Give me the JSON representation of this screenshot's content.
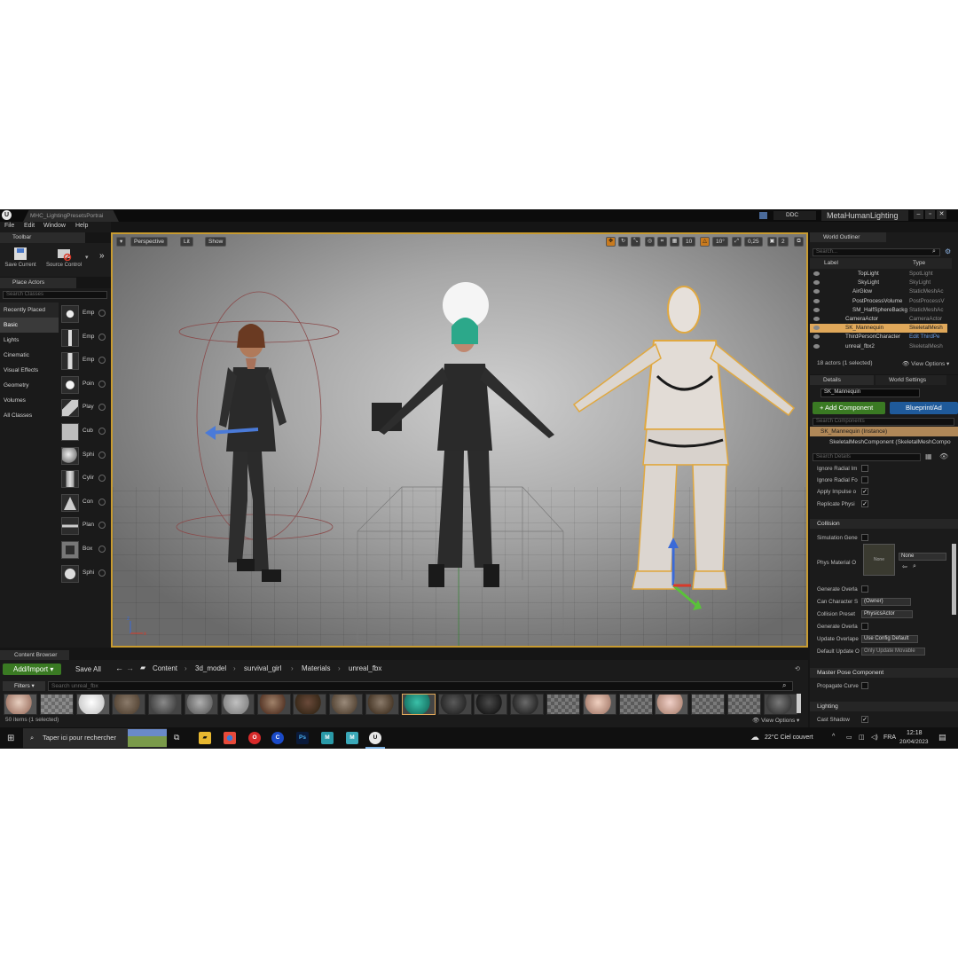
{
  "app": {
    "doc_tab": "MHC_LightingPresetsPortrai",
    "ddc": "DDC",
    "project_name": "MetaHumanLighting"
  },
  "menu": [
    "File",
    "Edit",
    "Window",
    "Help"
  ],
  "toolbar": {
    "tab": "Toolbar",
    "save_current": "Save Current",
    "source_control": "Source Control"
  },
  "place_actors": {
    "tab": "Place Actors",
    "search_placeholder": "Search Classes",
    "categories": [
      "Recently Placed",
      "Basic",
      "Lights",
      "Cinematic",
      "Visual Effects",
      "Geometry",
      "Volumes",
      "All Classes"
    ],
    "actors": [
      "Emp",
      "Emp",
      "Emp",
      "Poin",
      "Play",
      "Cub",
      "Sphi",
      "Cylir",
      "Con",
      "Plan",
      "Box",
      "Sphi"
    ]
  },
  "viewport": {
    "perspective": "Perspective",
    "lit": "Lit",
    "show": "Show",
    "grid_snap": "10",
    "rot_snap": "10°",
    "scale_snap": "0,25",
    "cam_speed": "2"
  },
  "outliner": {
    "tab": "World Outliner",
    "search_placeholder": "Search...",
    "col_label": "Label",
    "col_type": "Type",
    "rows": [
      {
        "name": "TopLight",
        "type": "SpotLight"
      },
      {
        "name": "SkyLight",
        "type": "SkyLight"
      },
      {
        "name": "AirGlow",
        "type": "StaticMeshAc"
      },
      {
        "name": "PostProcessVolume",
        "type": "PostProcessV"
      },
      {
        "name": "SM_HalfSphereBackg",
        "type": "StaticMeshAc"
      },
      {
        "name": "CameraActor",
        "type": "CameraActor"
      },
      {
        "name": "SK_Mannequin",
        "type": "SkeletalMesh"
      },
      {
        "name": "ThirdPersonCharacter",
        "type": "Edit ThirdPe"
      },
      {
        "name": "unreal_fbx2",
        "type": "SkeletalMesh"
      }
    ],
    "status": "18 actors (1 selected)",
    "view_options": "View Options"
  },
  "details": {
    "tab": "Details",
    "tab2": "World Settings",
    "name_value": "SK_Mannequin",
    "add_component": "+ Add Component",
    "blueprint": "Blueprint/Ad",
    "search_components": "Search Components",
    "instance": "SK_Mannequin (Instance)",
    "component": "SkeletalMeshComponent (SkeletalMeshCompo",
    "search_details": "Search Details",
    "props_top": [
      {
        "label": "Ignore Radial Im",
        "checked": false
      },
      {
        "label": "Ignore Radial Fo",
        "checked": false
      },
      {
        "label": "Apply Impulse o",
        "checked": true
      },
      {
        "label": "Replicate Physi",
        "checked": true
      }
    ],
    "collision": {
      "header": "Collision",
      "sim_gen": "Simulation Gene",
      "phys_mat": "Phys Material O",
      "phys_none_thumb": "None",
      "phys_none_dd": "None",
      "gen_overlap": "Generate Overla",
      "can_char": "Can Character S",
      "can_char_val": "(Owner)",
      "preset": "Collision Preset",
      "preset_val": "PhysicsActor",
      "gen_overlap2": "Generate Overla",
      "upd_overlap": "Update Overlape",
      "upd_overlap_val": "Use Config Default",
      "def_update": "Default Update O",
      "def_update_val": "Only Update Movable"
    },
    "master_pose": "Master Pose Component",
    "propagate": "Propagate Curve",
    "lighting": "Lighting",
    "cast_shadow": "Cast Shadow"
  },
  "content_browser": {
    "tab": "Content Browser",
    "add_import": "Add/Import",
    "save_all": "Save All",
    "path": [
      "Content",
      "3d_model",
      "survival_girl",
      "Materials",
      "unreal_fbx"
    ],
    "filters": "Filters",
    "search_placeholder": "Search unreal_fbx",
    "status": "50 items (1 selected)",
    "view_options": "View Options"
  },
  "taskbar": {
    "search": "Taper ici pour rechercher",
    "weather": "22°C  Ciel couvert",
    "lang": "FRA",
    "time": "12:18",
    "date": "20/04/2023"
  },
  "colors": {
    "accent_orange": "#c89b30",
    "selection": "#e0a85a",
    "add_green": "#3a7a23",
    "blueprint_blue": "#1f5a9a"
  }
}
